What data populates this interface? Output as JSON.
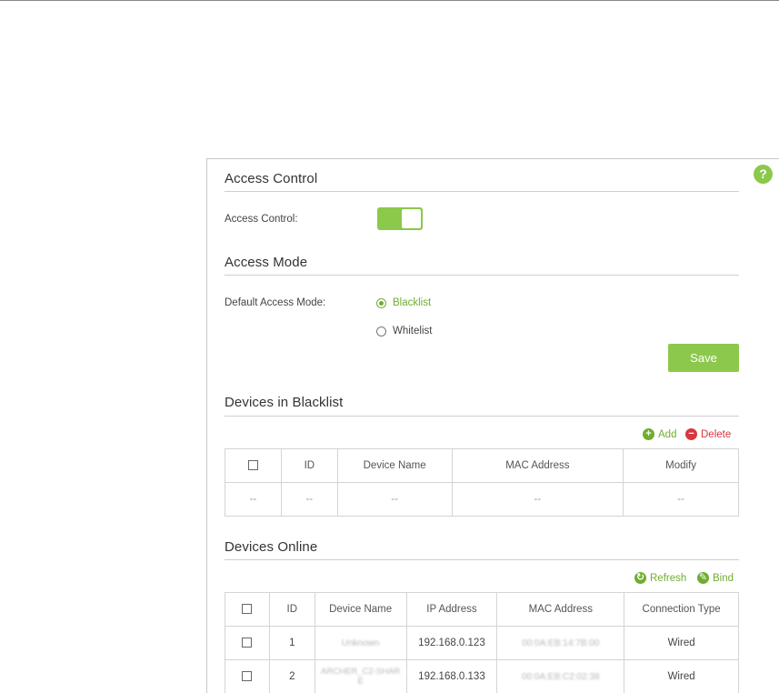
{
  "help_icon": "?",
  "access_control": {
    "title": "Access Control",
    "label": "Access Control:",
    "enabled": true
  },
  "access_mode": {
    "title": "Access Mode",
    "label": "Default Access Mode:",
    "options": [
      "Blacklist",
      "Whitelist"
    ],
    "selected": "Blacklist",
    "save_label": "Save"
  },
  "blacklist": {
    "title": "Devices in Blacklist",
    "add_label": "Add",
    "delete_label": "Delete",
    "columns": [
      "ID",
      "Device Name",
      "MAC Address",
      "Modify"
    ],
    "empty_cell": "--"
  },
  "online": {
    "title": "Devices Online",
    "refresh_label": "Refresh",
    "bind_label": "Bind",
    "columns": [
      "ID",
      "Device Name",
      "IP Address",
      "MAC Address",
      "Connection Type"
    ],
    "rows": [
      {
        "id": "1",
        "name": "Unknown",
        "ip": "192.168.0.123",
        "mac": "00:0A:EB:14:7B:00",
        "type": "Wired"
      },
      {
        "id": "2",
        "name": "ARCHER_C2-SHARE",
        "ip": "192.168.0.133",
        "mac": "00:0A:EB:C2:02:38",
        "type": "Wired"
      }
    ]
  },
  "colors": {
    "accent": "#8cc84b",
    "danger": "#d9363e"
  }
}
